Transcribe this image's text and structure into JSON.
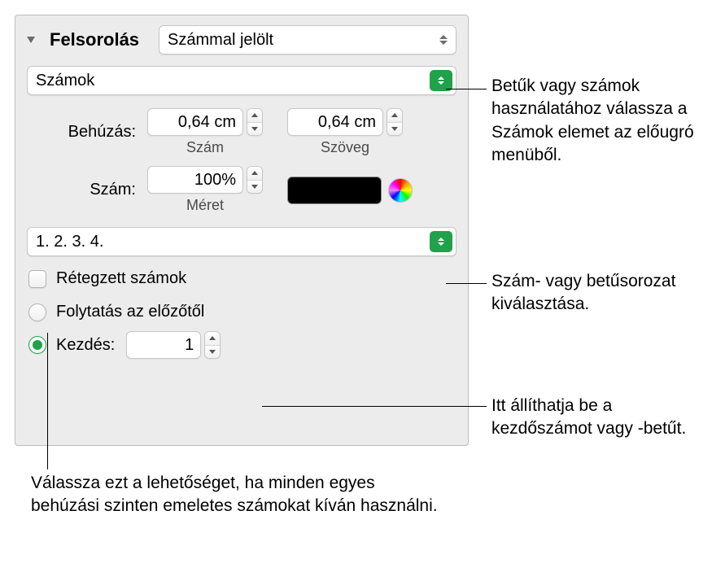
{
  "header": {
    "section_label": "Felsorolás",
    "type_select": "Számmal jelölt"
  },
  "format_select": "Számok",
  "indent": {
    "label": "Behúzás:",
    "number_value": "0,64 cm",
    "number_caption": "Szám",
    "text_value": "0,64 cm",
    "text_caption": "Szöveg"
  },
  "size": {
    "label": "Szám:",
    "value": "100%",
    "caption": "Méret"
  },
  "numbering_select": "1. 2. 3. 4.",
  "tiered": {
    "label": "Rétegzett számok"
  },
  "continue": {
    "label": "Folytatás az előzőtől"
  },
  "start": {
    "label": "Kezdés:",
    "value": "1"
  },
  "callouts": {
    "format": "Betűk vagy számok használatához válassza a Számok elemet az előugró menüből.",
    "numbering": "Szám- vagy betűsorozat kiválasztása.",
    "start": "Itt állíthatja be a kezdőszámot vagy -betűt.",
    "tiered": "Válassza ezt a lehetőséget, ha minden egyes behúzási szinten emeletes számokat kíván használni."
  }
}
